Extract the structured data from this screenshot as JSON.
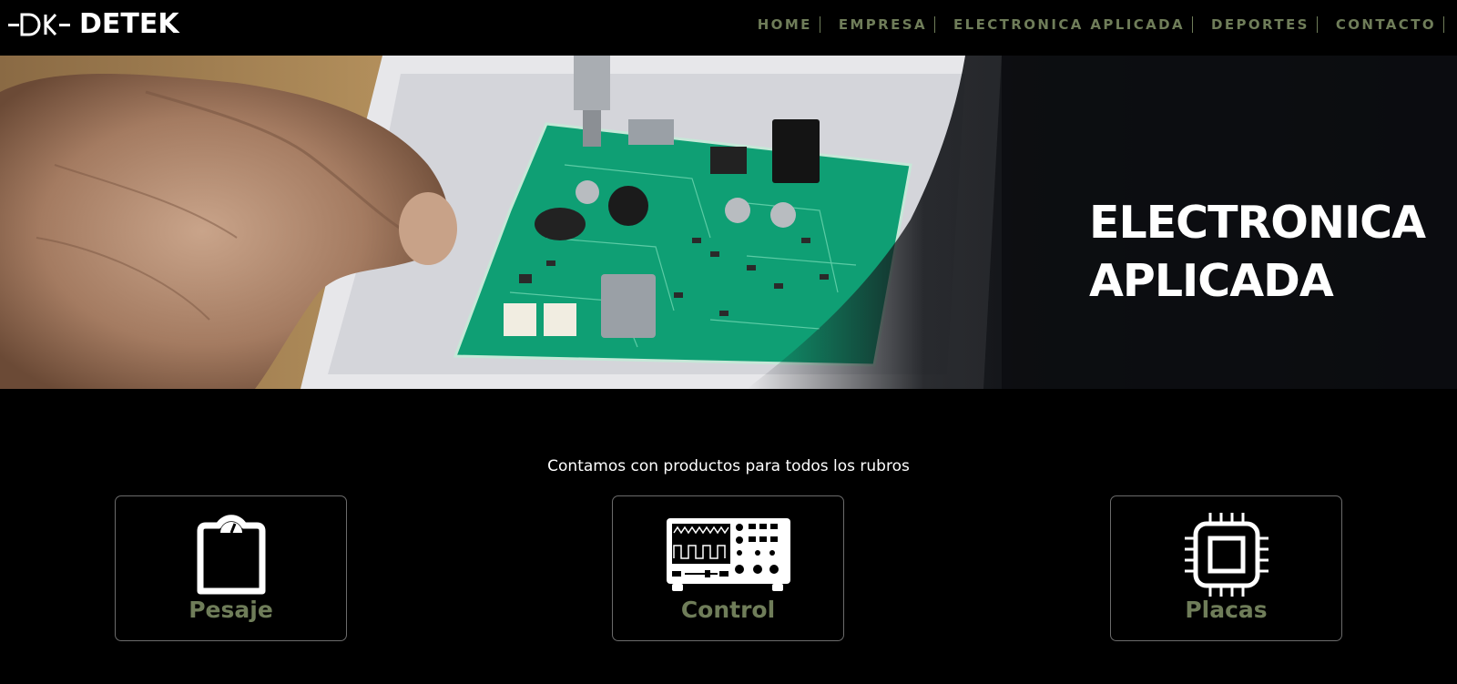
{
  "brand": {
    "logo_mark": "-DK-",
    "name": "DETEK"
  },
  "nav": {
    "items": [
      {
        "label": "HOME"
      },
      {
        "label": "EMPRESA"
      },
      {
        "label": "ELECTRONICA APLICADA"
      },
      {
        "label": "DEPORTES"
      },
      {
        "label": "CONTACTO"
      }
    ]
  },
  "hero": {
    "title_line1": "ELECTRONICA",
    "title_line2": "APLICADA"
  },
  "products": {
    "intro": "Contamos con productos para todos los rubros",
    "cards": [
      {
        "label": "Pesaje",
        "icon": "scale-icon"
      },
      {
        "label": "Control",
        "icon": "oscilloscope-icon"
      },
      {
        "label": "Placas",
        "icon": "chip-icon"
      }
    ]
  },
  "colors": {
    "accent": "#6f7d59",
    "background": "#000000",
    "text": "#ffffff",
    "pcb_green": "#0f9f74"
  }
}
